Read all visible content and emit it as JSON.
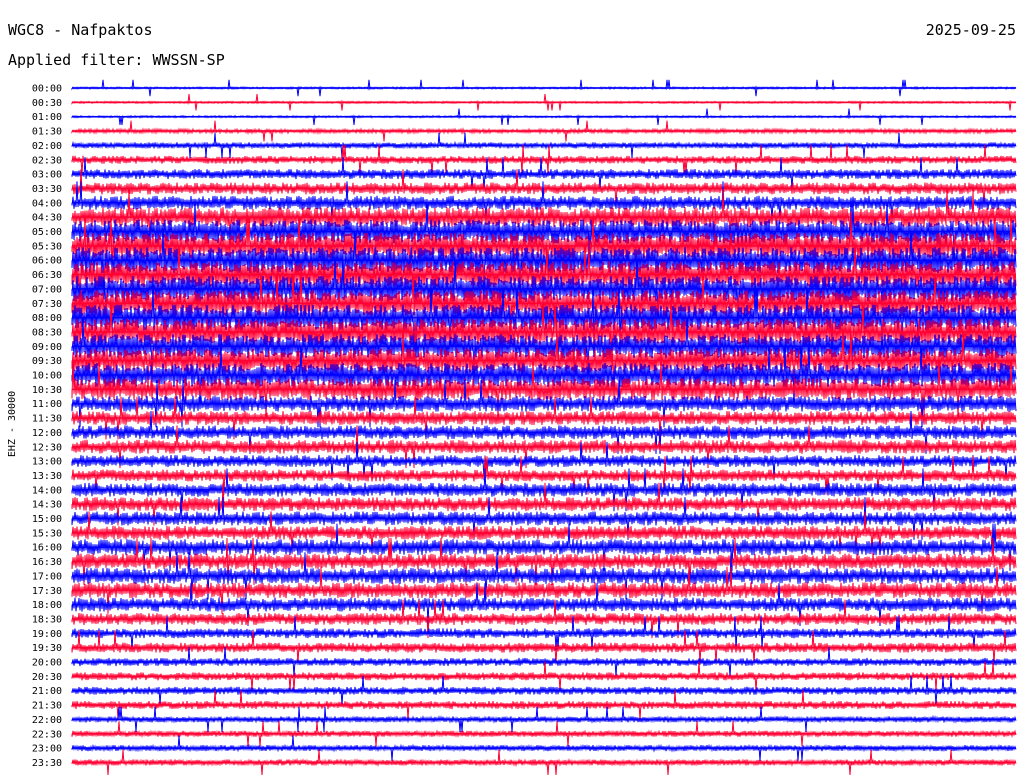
{
  "header": {
    "station": "WGC8 - Nafpaktos",
    "date": "2025-09-25",
    "filter": "Applied filter: WWSSN-SP"
  },
  "chart_data": {
    "type": "line",
    "title": "WGC8 - Nafpaktos",
    "ylabel": "EHZ - 30000",
    "colors": [
      "#0000ff",
      "#ff0033"
    ],
    "row_labels": [
      "00:00",
      "00:30",
      "01:00",
      "01:30",
      "02:00",
      "02:30",
      "03:00",
      "03:30",
      "04:00",
      "04:30",
      "05:00",
      "05:30",
      "06:00",
      "06:30",
      "07:00",
      "07:30",
      "08:00",
      "08:30",
      "09:00",
      "09:30",
      "10:00",
      "10:30",
      "11:00",
      "11:30",
      "12:00",
      "12:30",
      "13:00",
      "13:30",
      "14:00",
      "14:30",
      "15:00",
      "15:30",
      "16:00",
      "16:30",
      "17:00",
      "17:30",
      "18:00",
      "18:30",
      "19:00",
      "19:30",
      "20:00",
      "20:30",
      "21:00",
      "21:30",
      "22:00",
      "22:30",
      "23:00",
      "23:30"
    ],
    "amplitude": [
      1,
      1,
      1,
      2,
      3,
      4,
      5,
      6,
      7,
      10,
      12,
      13,
      13,
      13,
      13,
      13,
      13,
      13,
      12,
      12,
      12,
      11,
      8,
      7,
      7,
      7,
      6,
      6,
      7,
      7,
      7,
      7,
      8,
      8,
      8,
      8,
      7,
      6,
      5,
      5,
      4,
      4,
      4,
      4,
      3,
      3,
      3,
      3
    ]
  }
}
